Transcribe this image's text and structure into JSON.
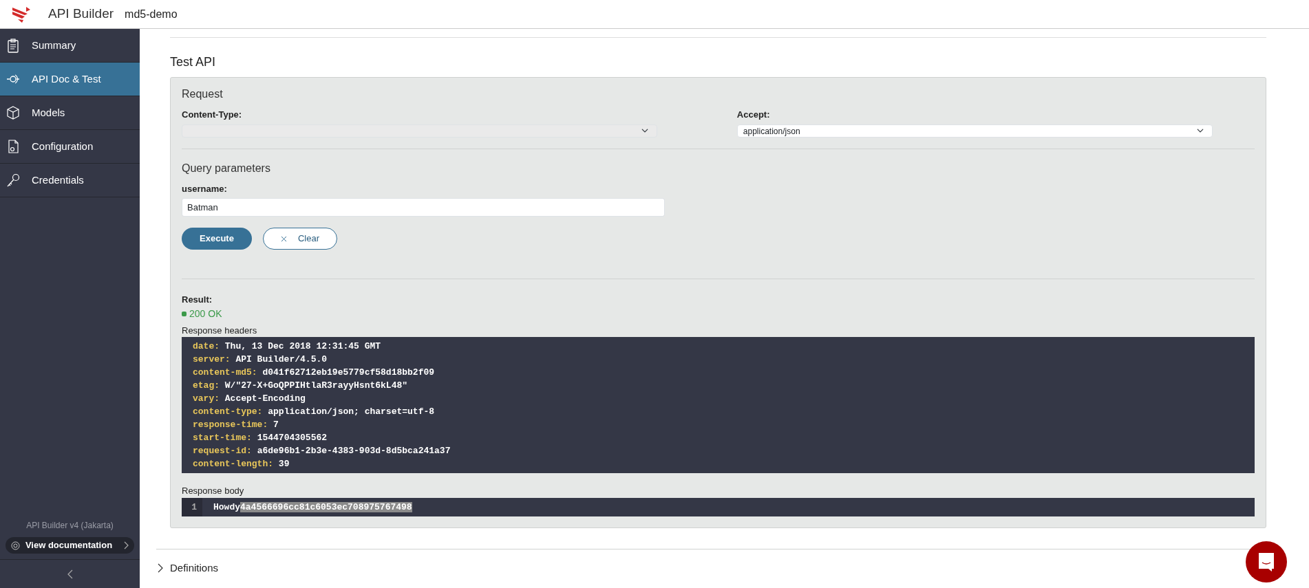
{
  "header": {
    "app_title": "API Builder",
    "project": "md5-demo"
  },
  "sidebar": {
    "items": [
      {
        "label": "Summary",
        "selected": false
      },
      {
        "label": "API Doc & Test",
        "selected": true
      },
      {
        "label": "Models",
        "selected": false
      },
      {
        "label": "Configuration",
        "selected": false
      },
      {
        "label": "Credentials",
        "selected": false
      }
    ],
    "version": "API Builder v4 (Jakarta)",
    "doc_button": "View documentation"
  },
  "test_api": {
    "title": "Test API",
    "request": {
      "heading": "Request",
      "fields": [
        {
          "label": "Content-Type:"
        },
        {
          "label": "Accept:",
          "value": "application/json"
        }
      ]
    },
    "query": {
      "heading": "Query parameters",
      "params": [
        {
          "label": "username:",
          "value": "Batman"
        }
      ]
    },
    "buttons": [
      {
        "label": "Execute",
        "kind": "primary"
      },
      {
        "label": "Clear",
        "kind": "clear"
      }
    ],
    "result": {
      "label": "Result:",
      "status": "200 OK"
    },
    "response_headers": {
      "label": "Response headers",
      "lines": [
        {
          "key": "date:",
          "value": "Thu, 13 Dec 2018 12:31:45 GMT"
        },
        {
          "key": "server:",
          "value": "API Builder/4.5.0"
        },
        {
          "key": "content-md5:",
          "value": "d041f62712eb19e5779cf58d18bb2f09"
        },
        {
          "key": "etag:",
          "value": "W/\"27-X+GoQPPIHtlaR3rayyHsnt6kL48\""
        },
        {
          "key": "vary:",
          "value": "Accept-Encoding"
        },
        {
          "key": "content-type:",
          "value": "application/json; charset=utf-8"
        },
        {
          "key": "response-time:",
          "value": "7"
        },
        {
          "key": "start-time:",
          "value": "1544704305562"
        },
        {
          "key": "request-id:",
          "value": "a6de96b1-2b3e-4383-903d-8d5bca241a37"
        },
        {
          "key": "content-length:",
          "value": "39"
        }
      ]
    },
    "response_body": {
      "label": "Response body",
      "lines": [
        {
          "number": "1",
          "segments": [
            {
              "text": "Howdy",
              "selected": false
            },
            {
              "text": "4a4566696cc81c6053ec708975767498",
              "selected": true
            }
          ]
        }
      ]
    }
  },
  "definitions": {
    "label": "Definitions",
    "expanded": false
  }
}
